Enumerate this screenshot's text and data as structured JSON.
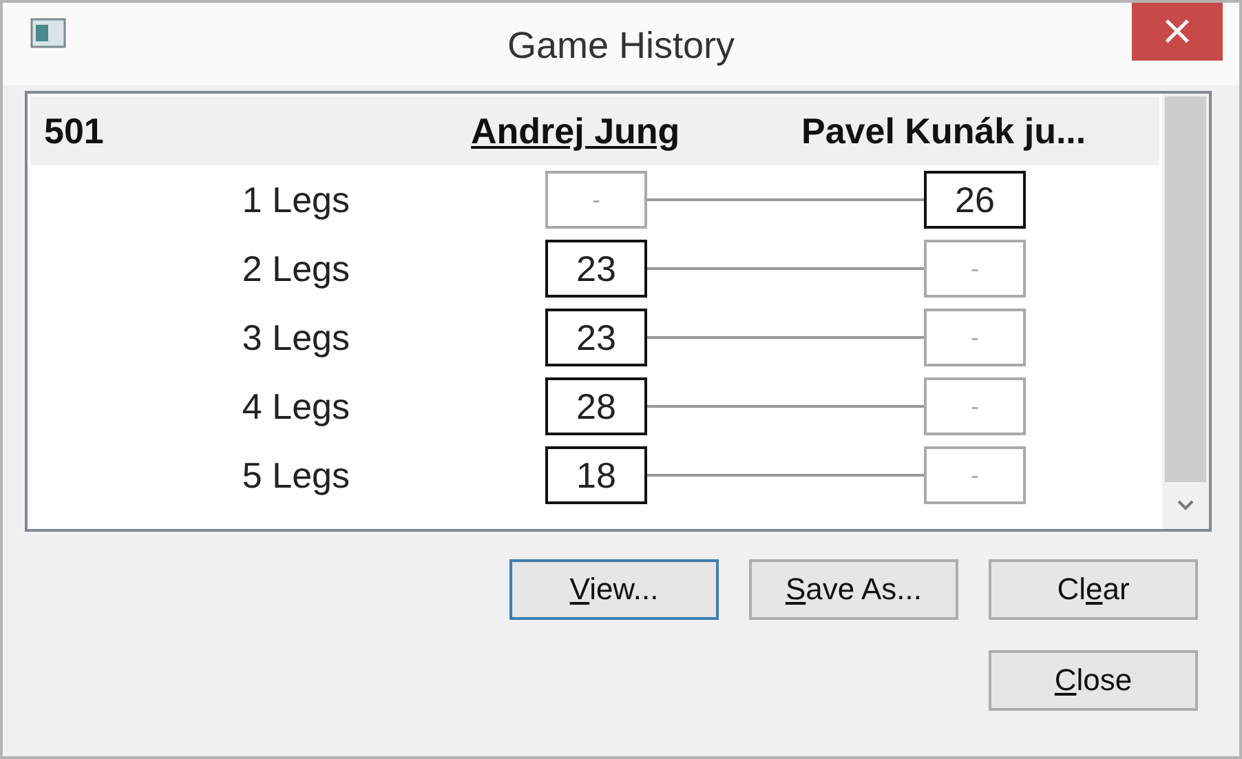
{
  "window": {
    "title": "Game History",
    "close": "×"
  },
  "table": {
    "game": "501",
    "players": [
      {
        "name": "Andrej Jung",
        "current": true
      },
      {
        "name": "Pavel Kunák ju...",
        "current": false
      }
    ],
    "rows": [
      {
        "label": "1 Legs",
        "cells": [
          {
            "value": "-",
            "won": false
          },
          {
            "value": "26",
            "won": true
          }
        ]
      },
      {
        "label": "2 Legs",
        "cells": [
          {
            "value": "23",
            "won": true
          },
          {
            "value": "-",
            "won": false
          }
        ]
      },
      {
        "label": "3 Legs",
        "cells": [
          {
            "value": "23",
            "won": true
          },
          {
            "value": "-",
            "won": false
          }
        ]
      },
      {
        "label": "4 Legs",
        "cells": [
          {
            "value": "28",
            "won": true
          },
          {
            "value": "-",
            "won": false
          }
        ]
      },
      {
        "label": "5 Legs",
        "cells": [
          {
            "value": "18",
            "won": true
          },
          {
            "value": "-",
            "won": false
          }
        ]
      }
    ]
  },
  "buttons": [
    {
      "key": "V",
      "post": "iew...",
      "focused": true
    },
    {
      "key": "S",
      "post": "ave As...",
      "focused": false
    },
    {
      "pre": "Cl",
      "key": "e",
      "post": "ar",
      "focused": false
    },
    {
      "key": "C",
      "post": "lose",
      "focused": false
    }
  ]
}
